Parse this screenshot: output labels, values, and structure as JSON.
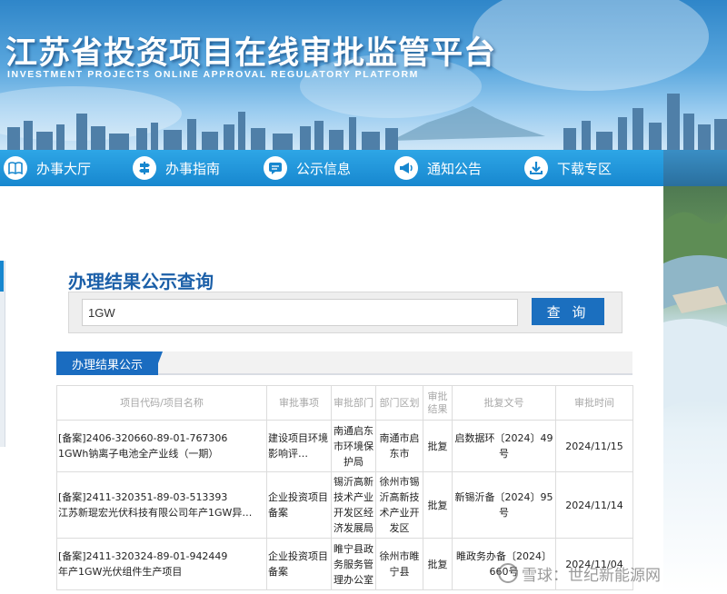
{
  "header": {
    "title": "江苏省投资项目在线审批监管平台",
    "subtitle": "INVESTMENT PROJECTS ONLINE APPROVAL REGULATORY PLATFORM"
  },
  "nav": {
    "items": [
      {
        "label": "办事大厅",
        "icon": "book-icon"
      },
      {
        "label": "办事指南",
        "icon": "signpost-icon"
      },
      {
        "label": "公示信息",
        "icon": "message-icon"
      },
      {
        "label": "通知公告",
        "icon": "megaphone-icon"
      },
      {
        "label": "下载专区",
        "icon": "download-icon"
      }
    ]
  },
  "query": {
    "title": "办理结果公示查询",
    "input_value": "1GW",
    "button_label": "查 询"
  },
  "results_tab": {
    "label": "办理结果公示"
  },
  "table": {
    "headers": [
      "项目代码/项目名称",
      "审批事项",
      "审批部门",
      "部门区划",
      "审批结果",
      "批复文号",
      "审批时间"
    ],
    "rows": [
      {
        "code": "[备案]2406-320660-89-01-767306",
        "name": "1GWh钠离子电池全产业线（一期）",
        "item": "建设项目环境影响评…",
        "dept": "南通启东市环境保护局",
        "region": "南通市启东市",
        "result": "批复",
        "doc": "启数据环〔2024〕49号",
        "date": "2024/11/15"
      },
      {
        "code": "[备案]2411-320351-89-03-513393",
        "name": "江苏新琨宏光伏科技有限公司年产1GW异…",
        "item": "企业投资项目备案",
        "dept": "锡沂高新技术产业开发区经济发展局",
        "region": "徐州市锡沂高新技术产业开发区",
        "result": "批复",
        "doc": "新锡沂备〔2024〕95号",
        "date": "2024/11/14"
      },
      {
        "code": "[备案]2411-320324-89-01-942449",
        "name": "年产1GW光伏组件生产项目",
        "item": "企业投资项目备案",
        "dept": "睢宁县政务服务管理办公室",
        "region": "徐州市睢宁县",
        "result": "批复",
        "doc": "睢政务办备〔2024〕660号",
        "date": "2024/11/04"
      }
    ]
  },
  "watermark": {
    "text": "雪球：世纪新能源网"
  },
  "colors": {
    "nav_blue": "#1787cf",
    "title_blue": "#1b5fa8",
    "button_blue": "#1b6fbf",
    "header_gray": "#a8a8a8"
  }
}
